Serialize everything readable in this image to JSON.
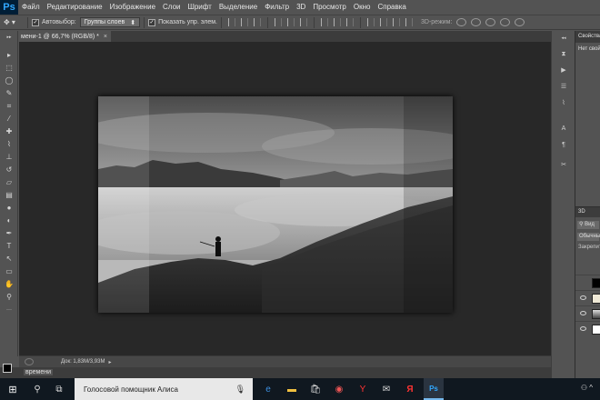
{
  "app": {
    "logo": "Ps",
    "brand_color": "#31a8ff"
  },
  "menu": [
    "Файл",
    "Редактирование",
    "Изображение",
    "Слои",
    "Шрифт",
    "Выделение",
    "Фильтр",
    "3D",
    "Просмотр",
    "Окно",
    "Справка"
  ],
  "options": {
    "tool_icon": "move-tool-icon",
    "autoselect_label": "Автовыбор:",
    "autoselect_checked": true,
    "autoselect_value": "Группы слоев",
    "show_controls_label": "Показать упр. элем.",
    "show_controls_checked": true,
    "mode3d_label": "3D-режим:"
  },
  "document": {
    "tab_title": "мени-1 @ 66,7% (RGB/8) *",
    "close_glyph": "×"
  },
  "status": {
    "doc_size": "Док: 1,83M/3,93M",
    "arrow": "▸"
  },
  "timeline": {
    "label": "времени"
  },
  "right_panel": {
    "properties_title": "Свойства",
    "properties_empty": "Нет свойств",
    "layers_tab": "3D",
    "layers_search_label": "Вид",
    "blend_mode": "Обычные",
    "lock_label": "Закрепить:"
  },
  "taskbar": {
    "start_icon": "windows-logo",
    "search_icon": "search-icon",
    "cortana_text": "Голосовой помощник Алиса",
    "mic_icon": "microphone-icon",
    "tray_icon": "people-icon"
  },
  "colors": {
    "foreground": "#000000",
    "background": "#ffffff",
    "ui_panel": "#535353",
    "canvas_bg": "#282828"
  }
}
